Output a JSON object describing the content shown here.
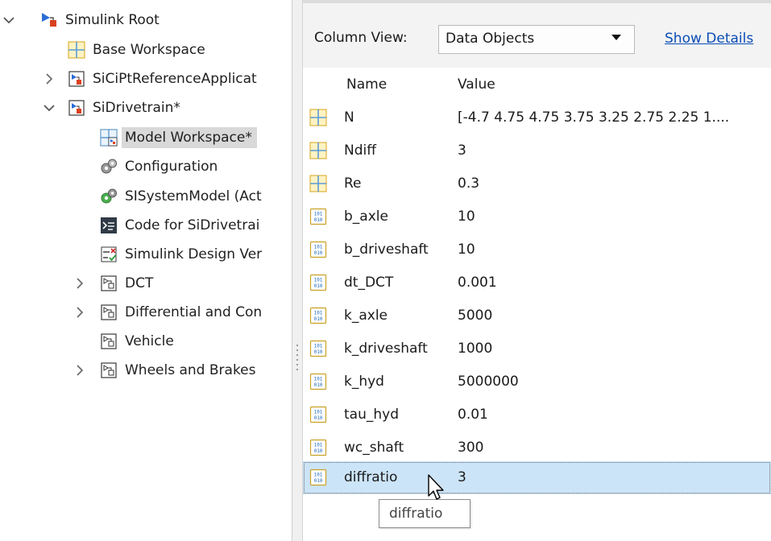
{
  "tree": {
    "root": {
      "label": "Simulink Root",
      "icon": "simulink-root-icon",
      "expanded": true
    },
    "base_workspace": {
      "label": "Base Workspace",
      "icon": "workspace-grid-icon"
    },
    "reference_app": {
      "label": "SiCiPtReferenceApplicat",
      "icon": "model-icon",
      "expanded": false
    },
    "drivetrain": {
      "label": "SiDrivetrain*",
      "icon": "model-icon",
      "expanded": true
    },
    "children": {
      "model_workspace": {
        "label": "Model Workspace*",
        "icon": "model-workspace-icon",
        "selected": true
      },
      "configuration": {
        "label": "Configuration",
        "icon": "gear-config-icon"
      },
      "system_model": {
        "label": "SISystemModel (Act",
        "icon": "green-gear-config-icon"
      },
      "code": {
        "label": "Code for SiDrivetrai",
        "icon": "code-terminal-icon"
      },
      "design_verifier": {
        "label": "Simulink Design Ver",
        "icon": "design-verifier-icon"
      },
      "dct": {
        "label": "DCT",
        "icon": "subsystem-icon",
        "expandable": true
      },
      "differential": {
        "label": "Differential and Con",
        "icon": "subsystem-icon",
        "expandable": true
      },
      "vehicle": {
        "label": "Vehicle",
        "icon": "subsystem-icon",
        "expandable": false
      },
      "wheels": {
        "label": "Wheels and Brakes",
        "icon": "subsystem-icon",
        "expandable": true
      }
    }
  },
  "toolbar": {
    "column_view_label": "Column View:",
    "column_view_value": "Data Objects",
    "show_details": "Show Details"
  },
  "table": {
    "headers": {
      "name": "Name",
      "value": "Value"
    },
    "rows": [
      {
        "name": "N",
        "value": "[-4.7 4.75 4.75 3.75 3.25 2.75 2.25 1....",
        "icon": "matrix-grid-icon"
      },
      {
        "name": "Ndiff",
        "value": "3",
        "icon": "matrix-grid-icon"
      },
      {
        "name": "Re",
        "value": "0.3",
        "icon": "matrix-grid-icon"
      },
      {
        "name": "b_axle",
        "value": "10",
        "icon": "binary-data-icon"
      },
      {
        "name": "b_driveshaft",
        "value": "10",
        "icon": "binary-data-icon"
      },
      {
        "name": "dt_DCT",
        "value": "0.001",
        "icon": "binary-data-icon"
      },
      {
        "name": "k_axle",
        "value": "5000",
        "icon": "binary-data-icon"
      },
      {
        "name": "k_driveshaft",
        "value": "1000",
        "icon": "binary-data-icon"
      },
      {
        "name": "k_hyd",
        "value": "5000000",
        "icon": "binary-data-icon"
      },
      {
        "name": "tau_hyd",
        "value": "0.01",
        "icon": "binary-data-icon"
      },
      {
        "name": "wc_shaft",
        "value": "300",
        "icon": "binary-data-icon"
      },
      {
        "name": "diffratio",
        "value": "3",
        "icon": "binary-data-icon",
        "selected": true
      }
    ]
  },
  "tooltip": {
    "text": "diffratio"
  },
  "colors": {
    "selected_row": "#cce4f7",
    "tree_selected": "#d9d9d9",
    "link": "#0b4db5",
    "toolbar_bg": "#f3f3f3"
  }
}
